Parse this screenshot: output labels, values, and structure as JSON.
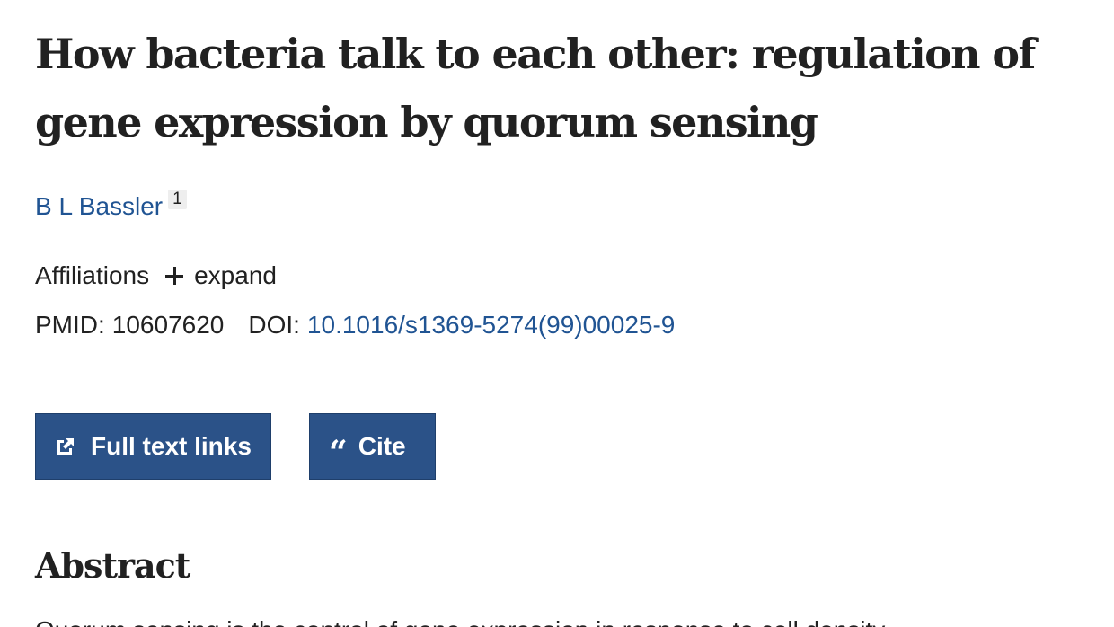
{
  "article": {
    "title": "How bacteria talk to each other: regulation of gene expression by quorum sensing",
    "author": "B L Bassler",
    "author_affiliation_ref": "1",
    "affiliations_label": "Affiliations",
    "affiliations_toggle": "expand",
    "pmid_label": "PMID:",
    "pmid": "10607620",
    "doi_label": "DOI:",
    "doi": "10.1016/s1369-5274(99)00025-9"
  },
  "actions": {
    "full_text_label": "Full text links",
    "full_text_icon": "external-link-icon",
    "cite_label": "Cite",
    "cite_icon": "quote-icon"
  },
  "abstract": {
    "heading": "Abstract",
    "text_partial": "Quorum sensing is the control of gene expression in response to cell density"
  },
  "colors": {
    "link": "#205493",
    "button_bg": "#2b5288",
    "text": "#212121"
  }
}
